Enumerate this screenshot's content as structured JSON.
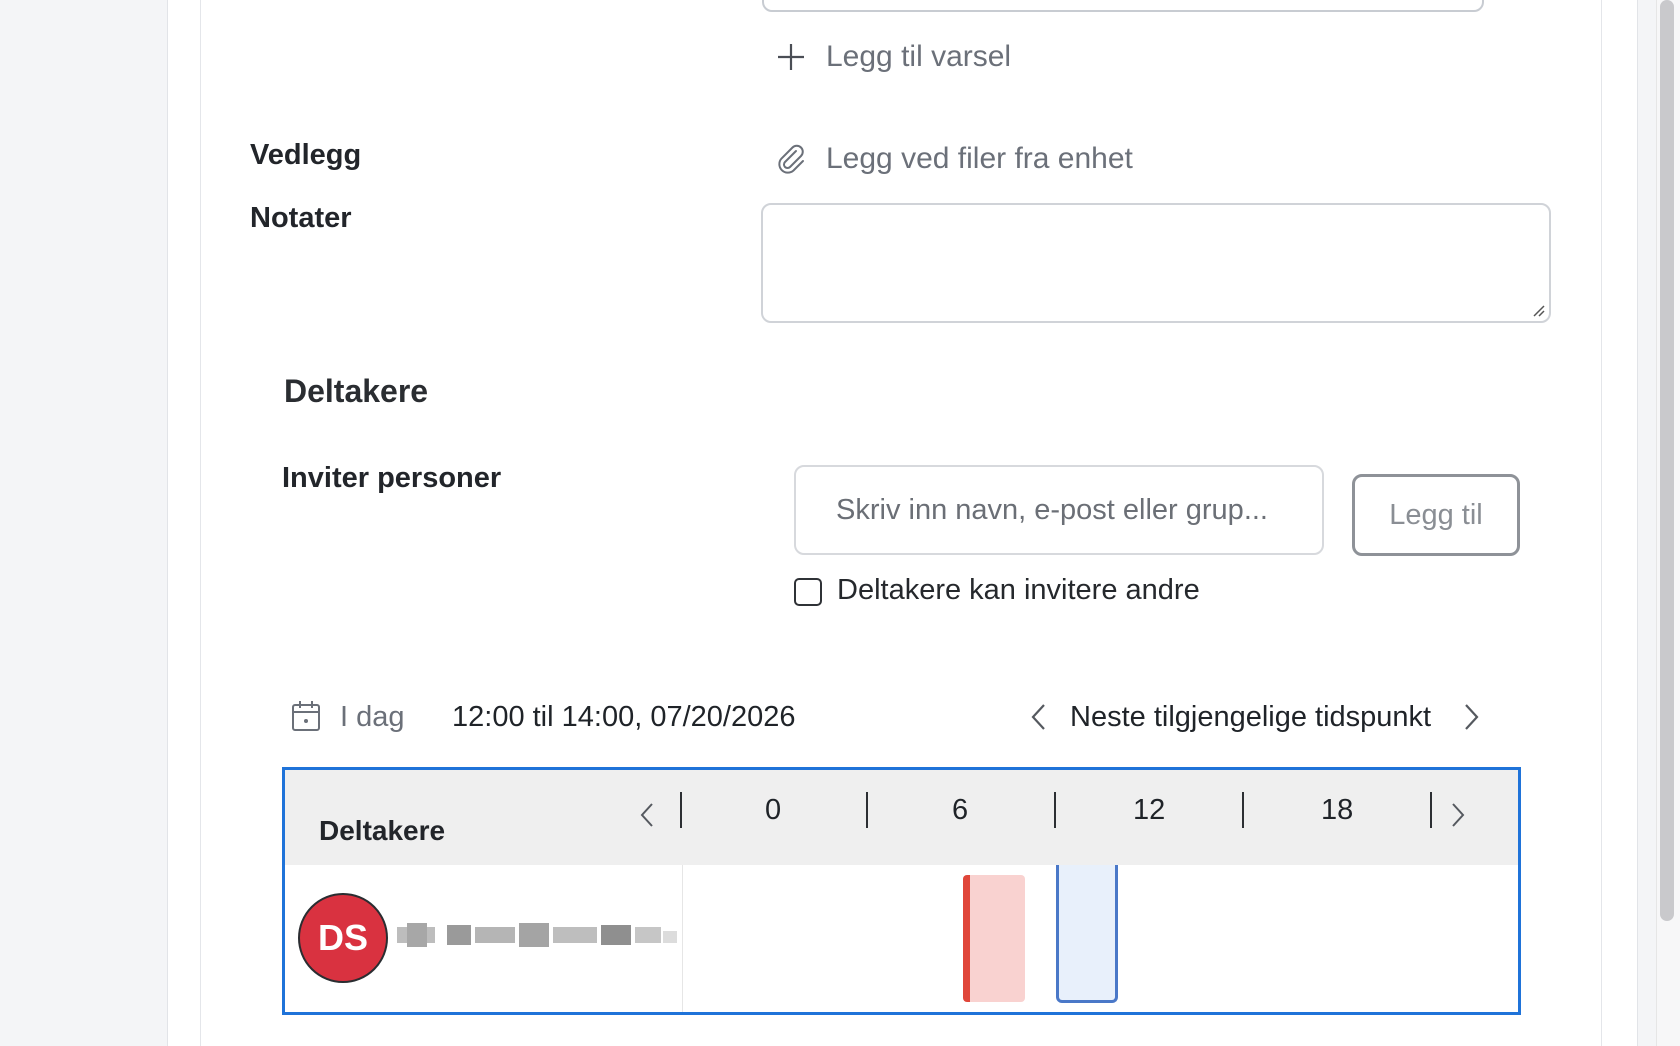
{
  "alerts": {
    "add_alert_label": "Legg til varsel"
  },
  "attachments": {
    "label": "Vedlegg",
    "attach_link": "Legg ved filer fra enhet"
  },
  "notes": {
    "label": "Notater",
    "value": ""
  },
  "participants": {
    "section_title": "Deltakere",
    "invite_label": "Inviter personer",
    "invite_input": {
      "placeholder": "Skriv inn navn, e-post eller grup...",
      "value": ""
    },
    "add_button": "Legg til",
    "can_invite_others": {
      "label": "Deltakere kan invitere andre",
      "checked": false
    }
  },
  "date_bar": {
    "today_label": "I dag",
    "range": "12:00 til 14:00, 07/20/2026",
    "next_available": "Neste tilgjengelige tidspunkt"
  },
  "scheduler": {
    "column_title": "Deltakere",
    "hours": [
      "0",
      "6",
      "12",
      "18"
    ],
    "selection_border": "#1f73d9",
    "rows": [
      {
        "initials": "DS",
        "avatar_color": "#d93240",
        "busy_color": "#e0463a"
      }
    ]
  }
}
